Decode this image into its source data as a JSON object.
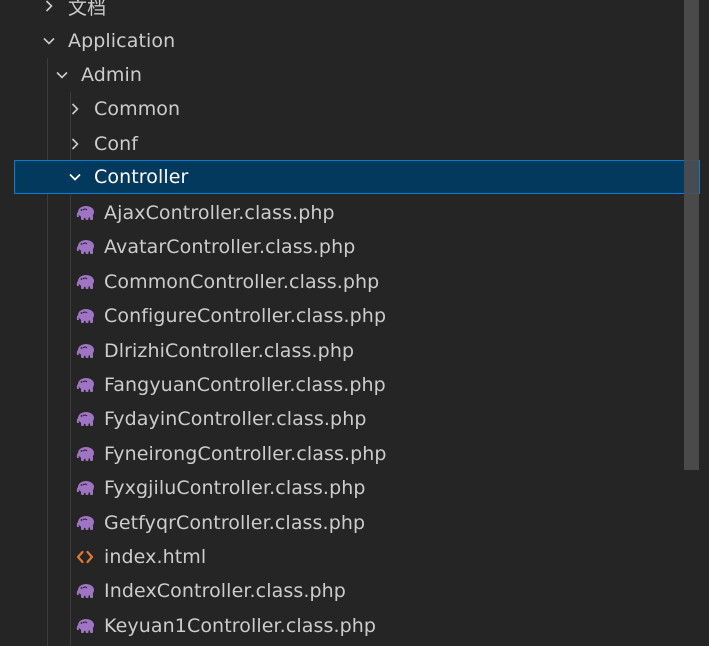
{
  "explorer": {
    "folders": {
      "docs": "文档",
      "application": "Application",
      "admin": "Admin",
      "common": "Common",
      "conf": "Conf",
      "controller": "Controller"
    },
    "files": [
      {
        "name": "AjaxController.class.php",
        "icon": "php-elephant-icon"
      },
      {
        "name": "AvatarController.class.php",
        "icon": "php-elephant-icon"
      },
      {
        "name": "CommonController.class.php",
        "icon": "php-elephant-icon"
      },
      {
        "name": "ConfigureController.class.php",
        "icon": "php-elephant-icon"
      },
      {
        "name": "DlrizhiController.class.php",
        "icon": "php-elephant-icon"
      },
      {
        "name": "FangyuanController.class.php",
        "icon": "php-elephant-icon"
      },
      {
        "name": "FydayinController.class.php",
        "icon": "php-elephant-icon"
      },
      {
        "name": "FyneirongController.class.php",
        "icon": "php-elephant-icon"
      },
      {
        "name": "FyxgjiluController.class.php",
        "icon": "php-elephant-icon"
      },
      {
        "name": "GetfyqrController.class.php",
        "icon": "php-elephant-icon"
      },
      {
        "name": "index.html",
        "icon": "html-brackets-icon"
      },
      {
        "name": "IndexController.class.php",
        "icon": "php-elephant-icon"
      },
      {
        "name": "Keyuan1Controller.class.php",
        "icon": "php-elephant-icon"
      }
    ]
  },
  "colors": {
    "background": "#252526",
    "text": "#cccccc",
    "selection_bg": "#04395e",
    "selection_border": "#007fd4",
    "php_icon": "#a074c4",
    "html_icon": "#e37933"
  }
}
